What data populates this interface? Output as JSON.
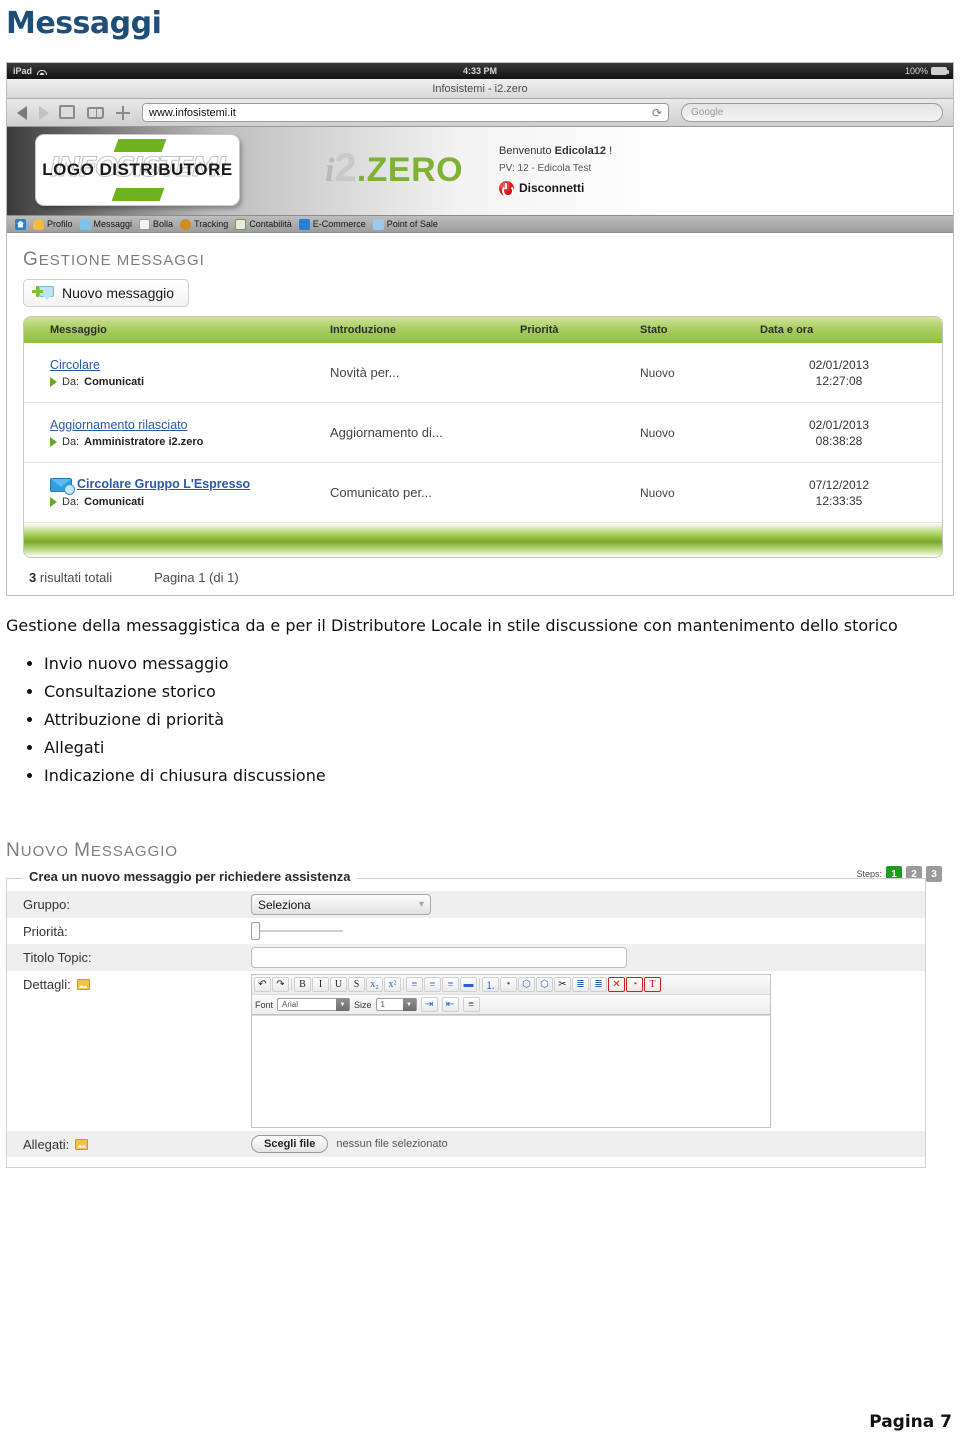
{
  "document": {
    "title": "Messaggi",
    "footer": "Pagina 7"
  },
  "ipad": {
    "device_label": "iPad",
    "clock": "4:33 PM",
    "battery": "100%",
    "page_title": "Infosistemi - i2.zero",
    "url": "www.infosistemi.it",
    "search_placeholder": "Google",
    "reload_icon": "reload-icon"
  },
  "app_header": {
    "logo_watermark": "INFOSISTEMI",
    "logo_text": "LOGO DISTRIBUTORE",
    "brand_i": "i",
    "brand_2": "2",
    "brand_zero": ".ZERO",
    "welcome_prefix": "Benvenuto ",
    "welcome_user": "Edicola12",
    "welcome_suffix": " !",
    "pv_line": "PV: 12 - Edicola Test",
    "logout_label": "Disconnetti",
    "accent_green": "#7fb233",
    "logout_red": "#cc0000"
  },
  "nav": {
    "items": [
      {
        "label": "",
        "icon": "home-icon"
      },
      {
        "label": "Profilo",
        "icon": "user-icon"
      },
      {
        "label": "Messaggi",
        "icon": "message-icon"
      },
      {
        "label": "Bolla",
        "icon": "document-icon"
      },
      {
        "label": "Tracking",
        "icon": "package-icon"
      },
      {
        "label": "Contabilità",
        "icon": "spreadsheet-icon"
      },
      {
        "label": "E-Commerce",
        "icon": "cart-icon"
      },
      {
        "label": "Point of Sale",
        "icon": "pos-icon"
      }
    ]
  },
  "messages_panel": {
    "heading_first": "G",
    "heading_rest": "ESTIONE MESSAGGI",
    "new_message_button": "Nuovo messaggio",
    "columns": [
      "Messaggio",
      "Introduzione",
      "Priorità",
      "Stato",
      "Data e ora"
    ],
    "rows": [
      {
        "title": "Circolare",
        "from_label": "Da:",
        "from": "Comunicati",
        "intro": "Novità per...",
        "priority": "green",
        "stato": "Nuovo",
        "data": "02/01/2013",
        "ora": "12:27:08",
        "has_attachment": false,
        "bold": false
      },
      {
        "title": "Aggiornamento rilasciato",
        "from_label": "Da:",
        "from": "Amministratore i2.zero",
        "intro": "Aggiornamento di...",
        "priority": "green",
        "stato": "Nuovo",
        "data": "02/01/2013",
        "ora": "08:38:28",
        "has_attachment": false,
        "bold": false
      },
      {
        "title": "Circolare Gruppo L'Espresso",
        "from_label": "Da:",
        "from": "Comunicati",
        "intro": "Comunicato per...",
        "priority": "green",
        "stato": "Nuovo",
        "data": "07/12/2012",
        "ora": "12:33:35",
        "has_attachment": true,
        "bold": true
      }
    ],
    "results_count": "3",
    "results_label": "risultati totali",
    "pagination": "Pagina  1  (di 1)"
  },
  "prose": {
    "paragraph": "Gestione della messaggistica da e per il Distributore Locale in stile discussione con mantenimento dello storico",
    "features": [
      "Invio nuovo messaggio",
      "Consultazione storico",
      "Attribuzione di priorità",
      "Allegati",
      "Indicazione di chiusura discussione"
    ]
  },
  "new_message_panel": {
    "heading_n": "N",
    "heading_uovo": "UOVO ",
    "heading_m": "M",
    "heading_essaggio": "ESSAGGIO",
    "steps_label": "Steps:",
    "steps": [
      "1",
      "2",
      "3"
    ],
    "active_step": "1",
    "legend": "Crea un nuovo messaggio per richiedere assistenza",
    "fields": {
      "gruppo_label": "Gruppo:",
      "gruppo_value": "Seleziona",
      "priorita_label": "Priorità:",
      "titolo_label": "Titolo Topic:",
      "titolo_value": "",
      "dettagli_label": "Dettagli:",
      "allegati_label": "Allegati:",
      "file_button": "Scegli file",
      "file_note": "nessun file selezionato"
    },
    "editor_toolbar": {
      "buttons": [
        {
          "glyph": "↶",
          "name": "undo-icon"
        },
        {
          "glyph": "↷",
          "name": "redo-icon"
        },
        {
          "glyph": "B",
          "name": "bold-icon"
        },
        {
          "glyph": "I",
          "name": "italic-icon"
        },
        {
          "glyph": "U",
          "name": "underline-icon"
        },
        {
          "glyph": "S",
          "name": "strikethrough-icon"
        },
        {
          "glyph": "x₂",
          "name": "subscript-icon"
        },
        {
          "glyph": "x²",
          "name": "superscript-icon"
        },
        {
          "glyph": "≡",
          "name": "align-left-icon"
        },
        {
          "glyph": "≡",
          "name": "align-center-icon"
        },
        {
          "glyph": "≡",
          "name": "align-right-icon"
        },
        {
          "glyph": "▬",
          "name": "align-justify-icon"
        },
        {
          "glyph": "⒈",
          "name": "ordered-list-icon"
        },
        {
          "glyph": "•",
          "name": "unordered-list-icon"
        },
        {
          "glyph": "⬡",
          "name": "insert-link-icon"
        },
        {
          "glyph": "⬡",
          "name": "insert-anchor-icon"
        },
        {
          "glyph": "✂",
          "name": "remove-link-icon"
        },
        {
          "glyph": "≣",
          "name": "insert-table-icon"
        },
        {
          "glyph": "≣",
          "name": "delete-table-icon"
        },
        {
          "glyph": "✕",
          "name": "remove-format-icon"
        },
        {
          "glyph": "◔",
          "name": "background-color-icon"
        },
        {
          "glyph": "T",
          "name": "text-color-icon"
        }
      ],
      "font_label": "Font",
      "font_value": "Arial",
      "size_label": "Size",
      "size_value": "1",
      "indent_icons": [
        "indent-icon",
        "outdent-icon",
        "horizontal-rule-icon"
      ]
    }
  }
}
